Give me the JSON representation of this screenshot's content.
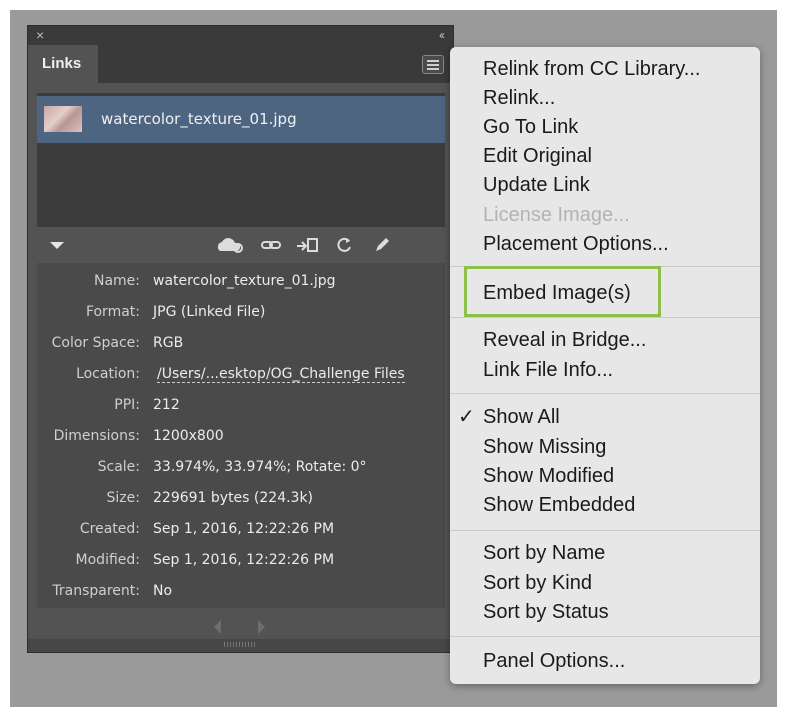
{
  "window": {
    "close_glyph": "×",
    "collapse_glyph": "‹‹"
  },
  "panel": {
    "tab_label": "Links",
    "selected_file": "watercolor_texture_01.jpg",
    "info": [
      {
        "label": "Name:",
        "value": "watercolor_texture_01.jpg"
      },
      {
        "label": "Format:",
        "value": "JPG (Linked File)"
      },
      {
        "label": "Color Space:",
        "value": "RGB"
      },
      {
        "label": "Location:",
        "value": "/Users/...esktop/OG_Challenge Files"
      },
      {
        "label": "PPI:",
        "value": "212"
      },
      {
        "label": "Dimensions:",
        "value": "1200x800"
      },
      {
        "label": "Scale:",
        "value": "33.974%, 33.974%; Rotate: 0°"
      },
      {
        "label": "Size:",
        "value": "229691 bytes (224.3k)"
      },
      {
        "label": "Created:",
        "value": "Sep 1, 2016, 12:22:26 PM"
      },
      {
        "label": "Modified:",
        "value": "Sep 1, 2016, 12:22:26 PM"
      },
      {
        "label": "Transparent:",
        "value": "No"
      }
    ],
    "toolbar_icons": [
      "cc-library-relink-icon",
      "relink-icon",
      "go-to-link-icon",
      "update-link-icon",
      "edit-original-icon"
    ]
  },
  "menu": {
    "groups": [
      [
        "Relink from CC Library...",
        "Relink...",
        "Go To Link",
        "Edit Original",
        "Update Link",
        "License Image...",
        "Placement Options..."
      ],
      [
        "Embed Image(s)"
      ],
      [
        "Reveal in Bridge...",
        "Link File Info..."
      ],
      [
        "Show All",
        "Show Missing",
        "Show Modified",
        "Show Embedded"
      ],
      [
        "Sort by Name",
        "Sort by Kind",
        "Sort by Status"
      ],
      [
        "Panel Options..."
      ]
    ],
    "disabled_item": "License Image...",
    "checked_item": "Show All",
    "check_glyph": "✓",
    "highlight_color": "#8cc04b"
  }
}
